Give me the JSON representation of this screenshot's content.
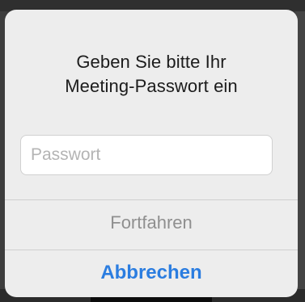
{
  "dialog": {
    "title_line1": "Geben Sie bitte Ihr",
    "title_line2": "Meeting-Passwort ein",
    "password_placeholder": "Passwort",
    "password_value": "",
    "continue_label": "Fortfahren",
    "cancel_label": "Abbrechen",
    "continue_enabled": false
  },
  "colors": {
    "dialog_background": "#ededed",
    "continue_disabled_text": "#8f8f8f",
    "cancel_text": "#2b7de0"
  }
}
